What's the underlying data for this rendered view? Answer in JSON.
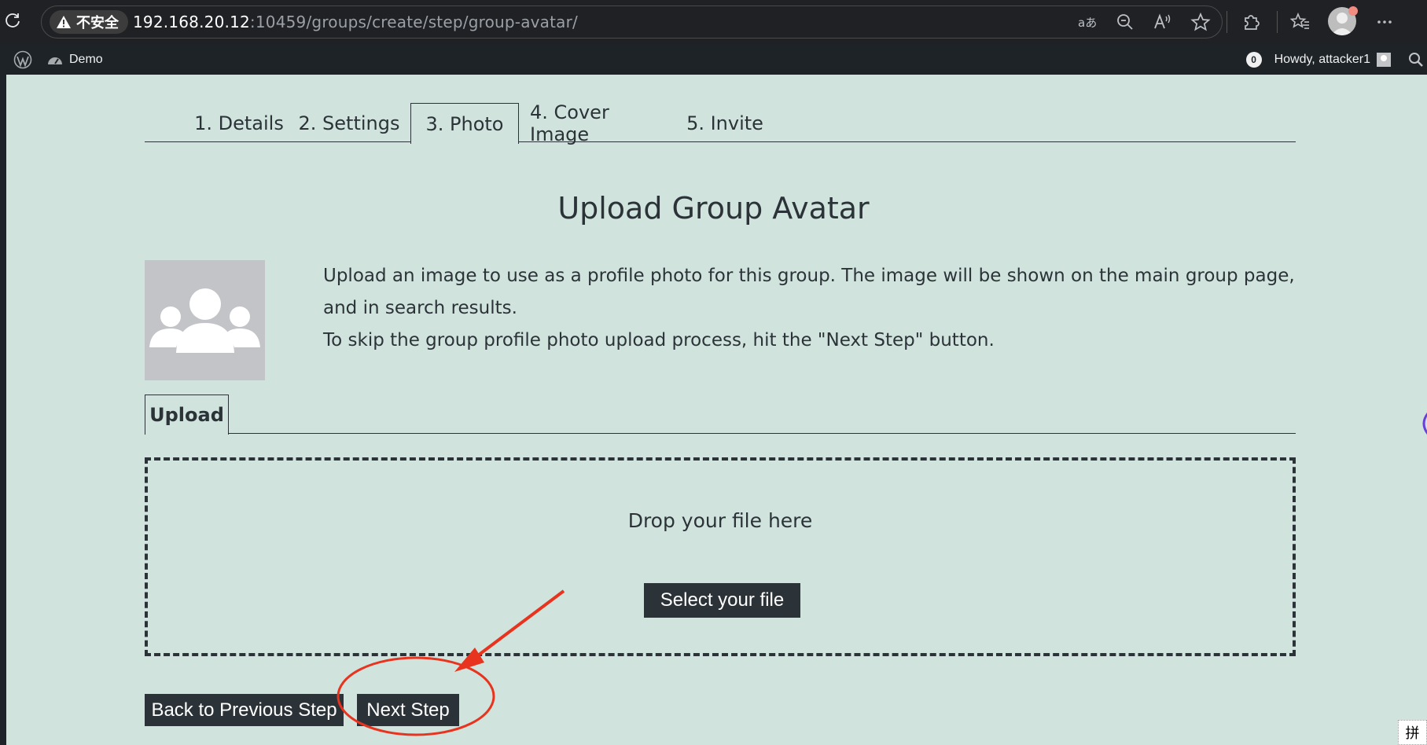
{
  "browser": {
    "insecure_label": "不安全",
    "url_host": "192.168.20.12",
    "url_path": ":10459/groups/create/step/group-avatar/",
    "icons": [
      "reload-icon",
      "warning-icon",
      "translate-icon",
      "zoom-out-icon",
      "read-aloud-icon",
      "favorite-star-icon",
      "extensions-icon",
      "favorites-list-icon",
      "profile-avatar",
      "more-menu-icon"
    ]
  },
  "adminbar": {
    "site_name": "Demo",
    "notifications": "0",
    "howdy": "Howdy, attacker1"
  },
  "steps": [
    {
      "label": "1. Details",
      "active": false
    },
    {
      "label": "2. Settings",
      "active": false
    },
    {
      "label": "3. Photo",
      "active": true
    },
    {
      "label": "4. Cover Image",
      "active": false
    },
    {
      "label": "5. Invite",
      "active": false
    }
  ],
  "page": {
    "title": "Upload Group Avatar",
    "desc_line1": "Upload an image to use as a profile photo for this group. The image will be shown on the main group page, and in search results.",
    "desc_line2": "To skip the group profile photo upload process, hit the \"Next Step\" button."
  },
  "upload": {
    "tab_label": "Upload",
    "drop_text": "Drop your file here",
    "select_button": "Select your file"
  },
  "nav": {
    "back_label": "Back to Previous Step",
    "next_label": "Next Step"
  },
  "ime": {
    "label": "拼"
  },
  "colors": {
    "page_bg": "#d0e4dd",
    "dark": "#2c3338",
    "adminbar": "#1d2327",
    "annotation": "#e8331e"
  }
}
